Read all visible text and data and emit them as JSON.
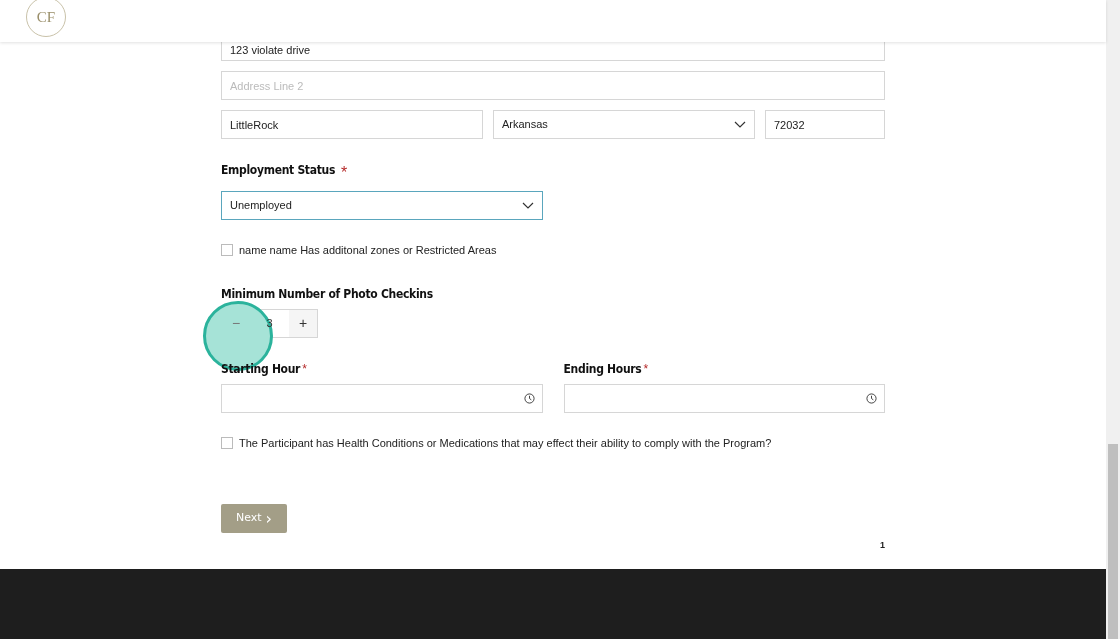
{
  "header": {
    "logo": "CF"
  },
  "address": {
    "line1": {
      "value": "123 violate drive"
    },
    "line2": {
      "placeholder": "Address Line 2"
    },
    "city": {
      "value": "LittleRock"
    },
    "state": {
      "value": "Arkansas"
    },
    "zip": {
      "value": "72032"
    }
  },
  "employment": {
    "label": "Employment Status",
    "required": "*",
    "value": "Unemployed",
    "focused": true
  },
  "zones_checkbox": {
    "label": "name name Has additonal zones or Restricted Areas",
    "checked": false
  },
  "photo_checkins": {
    "label": "Minimum Number of Photo Checkins",
    "minus": "−",
    "value": "3",
    "plus": "+"
  },
  "hours": [
    {
      "label": "Starting Hour",
      "required": "*"
    },
    {
      "label": "Ending Hours",
      "required": "*"
    }
  ],
  "health_checkbox": {
    "label": "The Participant has Health Conditions or Medications that may effect their ability to comply with the Program?",
    "checked": false
  },
  "next_button": {
    "label": "Next",
    "arrow": "›"
  },
  "page_number": "1"
}
